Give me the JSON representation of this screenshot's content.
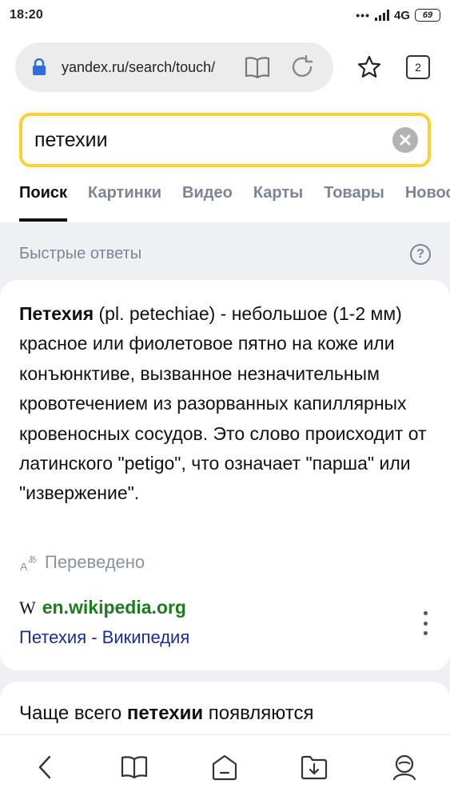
{
  "status_bar": {
    "time": "18:20",
    "network": "4G",
    "battery": "69"
  },
  "address_bar": {
    "url": "yandex.ru/search/touch/",
    "tabs_count": "2"
  },
  "search": {
    "query": "петехии"
  },
  "nav_tabs": [
    "Поиск",
    "Картинки",
    "Видео",
    "Карты",
    "Товары",
    "Новости"
  ],
  "quick_answers": {
    "header": "Быстрые ответы",
    "help": "?",
    "term": "Петехия",
    "definition": " (pl. petechiae) - небольшое (1-2 мм) красное или фиолетовое пятно на коже или конъюнктиве, вызванное незначительным кровотечением из разорванных капиллярных кровеносных сосудов. Это слово происходит от латинского \"petigo\", что означает \"парша\" или \"извержение\".",
    "translated_label": "Переведено",
    "source_icon": "W",
    "source_domain": "en.wikipedia.org",
    "source_link": "Петехия - Википедия"
  },
  "next_card": {
    "text_before": "Чаще всего ",
    "text_bold": "петехии",
    "text_after": " появляются"
  },
  "icons": {
    "lock": "lock-icon",
    "reader": "book-icon",
    "reload": "reload-icon",
    "bookmark": "star-icon",
    "clear": "close-icon",
    "back": "back-icon",
    "bookmarks": "book-icon",
    "home": "home-icon",
    "downloads": "download-icon",
    "profile": "profile-icon"
  },
  "colors": {
    "search_border": "#fdd02c",
    "link": "#1a2d96",
    "domain": "#1e7a1e",
    "muted": "#7c8596"
  }
}
